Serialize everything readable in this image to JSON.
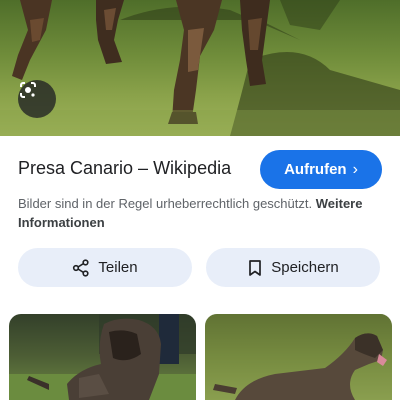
{
  "result": {
    "title": "Presa Canario – Wikipedia",
    "visit_label": "Aufrufen",
    "notice_text": "Bilder sind in der Regel urheberrechtlich geschützt.",
    "notice_link": "Weitere Informationen"
  },
  "actions": {
    "share_label": "Teilen",
    "save_label": "Speichern"
  },
  "icons": {
    "lens": "google-lens-icon",
    "visit": "chevron-right-icon",
    "share": "share-icon",
    "save": "bookmark-icon"
  },
  "colors": {
    "accent": "#1a73e8",
    "pill_bg": "#e8eef9",
    "text": "#202124",
    "muted": "#5f6368"
  }
}
